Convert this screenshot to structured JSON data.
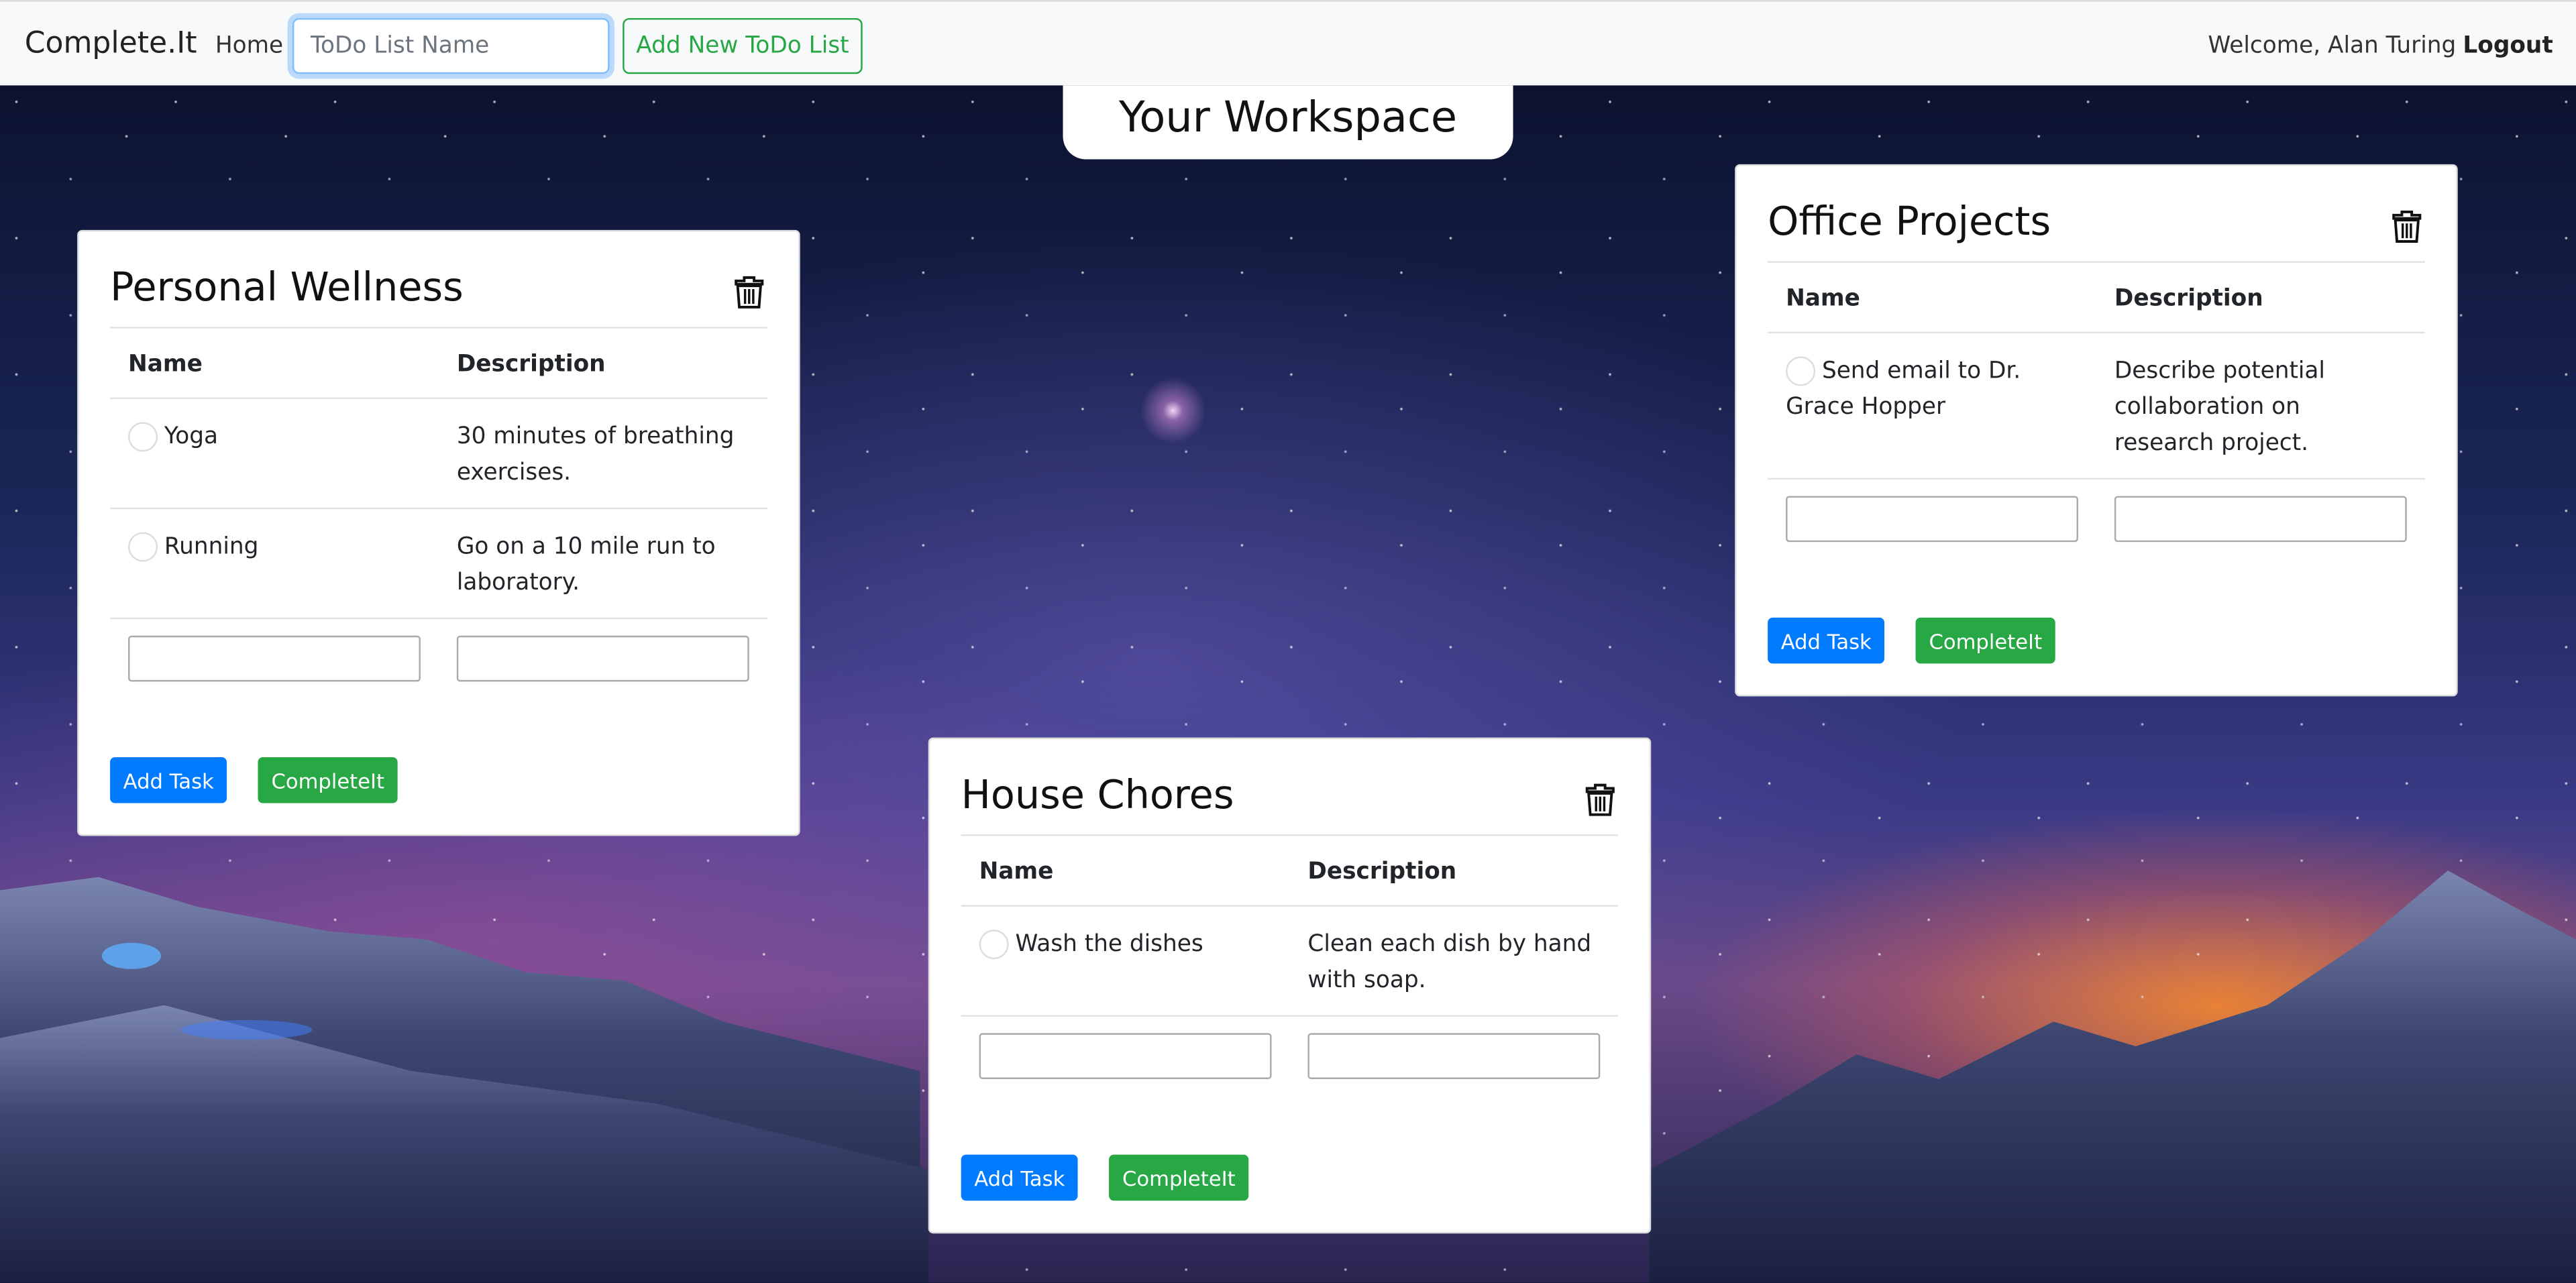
{
  "navbar": {
    "brand": "Complete.It",
    "home": "Home",
    "list_name_placeholder": "ToDo List Name",
    "add_list_label": "Add New ToDo List",
    "welcome": "Welcome, Alan Turing",
    "logout": "Logout"
  },
  "workspace_title": "Your Workspace",
  "colors": {
    "primary": "#007bff",
    "success": "#28a745",
    "navbar_bg": "#f8f9fa"
  },
  "lists": [
    {
      "title": "Personal Wellness",
      "headers": [
        "Name",
        "Description"
      ],
      "tasks": [
        {
          "name": "Yoga",
          "description": "30 minutes of breathing exercises."
        },
        {
          "name": "Running",
          "description": "Go on a 10 mile run to laboratory."
        }
      ],
      "add_task": "Add Task",
      "complete": "CompleteIt"
    },
    {
      "title": "Office Projects",
      "headers": [
        "Name",
        "Description"
      ],
      "tasks": [
        {
          "name": "Send email to Dr. Grace Hopper",
          "description": "Describe potential collaboration on research project."
        }
      ],
      "add_task": "Add Task",
      "complete": "CompleteIt"
    },
    {
      "title": "House Chores",
      "headers": [
        "Name",
        "Description"
      ],
      "tasks": [
        {
          "name": "Wash the dishes",
          "description": "Clean each dish by hand with soap."
        }
      ],
      "add_task": "Add Task",
      "complete": "CompleteIt"
    }
  ]
}
